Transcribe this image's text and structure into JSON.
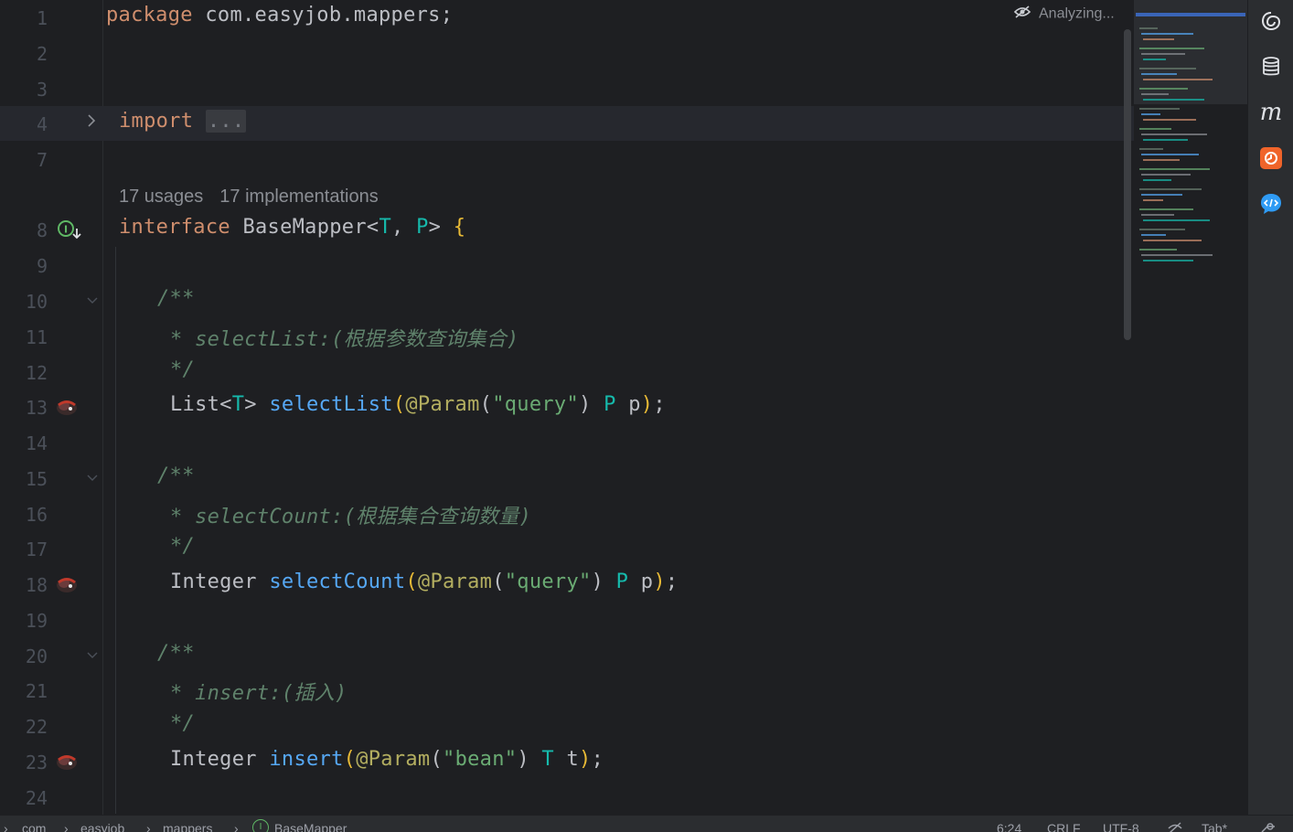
{
  "editor": {
    "status_text": "Analyzing...",
    "inlay_usages": "17 usages",
    "inlay_implementations": "17 implementations",
    "lines": [
      {
        "n": "1"
      },
      {
        "n": "2"
      },
      {
        "n": "3"
      },
      {
        "n": "4"
      },
      {
        "n": "7"
      },
      {
        "n": "8"
      },
      {
        "n": "9"
      },
      {
        "n": "10"
      },
      {
        "n": "11"
      },
      {
        "n": "12"
      },
      {
        "n": "13"
      },
      {
        "n": "14"
      },
      {
        "n": "15"
      },
      {
        "n": "16"
      },
      {
        "n": "17"
      },
      {
        "n": "18"
      },
      {
        "n": "19"
      },
      {
        "n": "20"
      },
      {
        "n": "21"
      },
      {
        "n": "22"
      },
      {
        "n": "23"
      },
      {
        "n": "24"
      }
    ],
    "code": {
      "l1_kw": "package",
      "l1_rest": " com.easyjob.mappers;",
      "l4_kw": "import",
      "l4_fold": "...",
      "l8_kw": "interface",
      "l8_name": " BaseMapper",
      "l8_lt": "<",
      "l8_t": "T",
      "l8_comma": ", ",
      "l8_p": "P",
      "l8_gt": ">",
      "l8_brace": " {",
      "doc_open": "/**",
      "doc_close": "*/",
      "l11_doc": "* selectList:(根据参数查询集合)",
      "l13_type": "List",
      "l13_lt": "<",
      "l13_t": "T",
      "l13_gt": ">",
      "l13_fn": " selectList",
      "l13_paren": "(",
      "l13_an": "@Param",
      "l13_p2": "(",
      "l13_str": "\"query\"",
      "l13_p3": ")",
      "l13_ptype": " P",
      "l13_end": " p",
      "l13_close": ")",
      "l13_semi": ";",
      "l16_doc": "* selectCount:(根据集合查询数量)",
      "l18_type": "Integer",
      "l18_fn": " selectCount",
      "l18_paren": "(",
      "l18_an": "@Param",
      "l18_p2": "(",
      "l18_str": "\"query\"",
      "l18_p3": ")",
      "l18_ptype": " P",
      "l18_end": " p",
      "l18_close": ")",
      "l18_semi": ";",
      "l21_doc": "* insert:(插入)",
      "l23_type": "Integer",
      "l23_fn": " insert",
      "l23_paren": "(",
      "l23_an": "@Param",
      "l23_p2": "(",
      "l23_str": "\"bean\"",
      "l23_p3": ")",
      "l23_ptype": " T",
      "l23_end": " t",
      "l23_close": ")",
      "l23_semi": ";"
    }
  },
  "right_toolbar": {
    "icons": [
      "ai-assistant-icon",
      "database-icon",
      "maven-icon",
      "plugin-icon",
      "chat-icon"
    ],
    "maven_glyph": "m"
  },
  "statusbar": {
    "breadcrumb": [
      "com",
      "easyjob",
      "mappers",
      "BaseMapper"
    ],
    "sep": "›",
    "interface_badge": "I",
    "position": "6:24",
    "line_ending": "CRLF",
    "encoding": "UTF-8",
    "indent": "Tab*"
  },
  "colors": {
    "background": "#1e1f22",
    "keyword": "#cf8e6d",
    "type_param": "#16baac",
    "function": "#56a8f5",
    "annotation": "#b3ae60",
    "string": "#6aab73",
    "comment": "#5f826b"
  }
}
